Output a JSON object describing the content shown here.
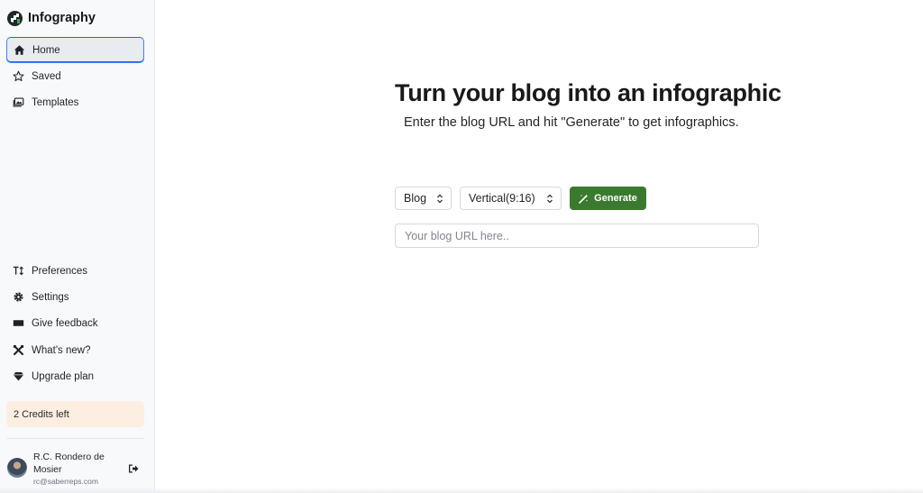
{
  "brand": {
    "name": "Infography",
    "icon": "infography-logo"
  },
  "nav_top": [
    {
      "label": "Home",
      "icon": "home-icon"
    },
    {
      "label": "Saved",
      "icon": "star-icon"
    },
    {
      "label": "Templates",
      "icon": "image-icon"
    }
  ],
  "nav_bottom": [
    {
      "label": "Preferences",
      "icon": "text-size-icon"
    },
    {
      "label": "Settings",
      "icon": "gear-icon"
    },
    {
      "label": "Give feedback",
      "icon": "ticket-icon"
    },
    {
      "label": "What's new?",
      "icon": "tools-icon"
    },
    {
      "label": "Upgrade plan",
      "icon": "diamond-icon"
    }
  ],
  "credits": "2 Credits left",
  "user": {
    "name": "R.C. Rondero de Mosier",
    "email": "rc@saberreps.com"
  },
  "main": {
    "headline": "Turn your blog into an infographic",
    "subhead": "Enter the blog URL and hit \"Generate\" to get infographics.",
    "source_select": "Blog",
    "format_select": "Vertical(9:16)",
    "generate_label": "Generate",
    "url_placeholder": "Your blog URL here.."
  },
  "colors": {
    "accent_green": "#3a7a2e",
    "credits_bg": "#fdeee2",
    "active_border": "#3b82f6"
  }
}
